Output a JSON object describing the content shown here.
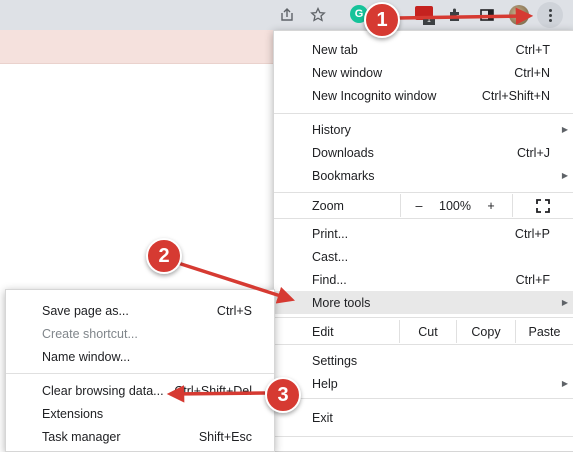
{
  "chrome_menu": {
    "new_tab": {
      "label": "New tab",
      "shortcut": "Ctrl+T"
    },
    "new_window": {
      "label": "New window",
      "shortcut": "Ctrl+N"
    },
    "new_incognito": {
      "label": "New Incognito window",
      "shortcut": "Ctrl+Shift+N"
    },
    "history": {
      "label": "History"
    },
    "downloads": {
      "label": "Downloads",
      "shortcut": "Ctrl+J"
    },
    "bookmarks": {
      "label": "Bookmarks"
    },
    "zoom": {
      "label": "Zoom",
      "minus": "–",
      "value": "100%",
      "plus": "+"
    },
    "print": {
      "label": "Print...",
      "shortcut": "Ctrl+P"
    },
    "cast": {
      "label": "Cast..."
    },
    "find": {
      "label": "Find...",
      "shortcut": "Ctrl+F"
    },
    "more_tools": {
      "label": "More tools"
    },
    "edit": {
      "label": "Edit",
      "cut": "Cut",
      "copy": "Copy",
      "paste": "Paste"
    },
    "settings": {
      "label": "Settings"
    },
    "help": {
      "label": "Help"
    },
    "exit": {
      "label": "Exit"
    }
  },
  "more_tools_menu": {
    "save_page": {
      "label": "Save page as...",
      "shortcut": "Ctrl+S"
    },
    "create_shortcut": {
      "label": "Create shortcut..."
    },
    "name_window": {
      "label": "Name window..."
    },
    "clear_browsing": {
      "label": "Clear browsing data...",
      "shortcut": "Ctrl+Shift+Del"
    },
    "extensions": {
      "label": "Extensions"
    },
    "task_manager": {
      "label": "Task manager",
      "shortcut": "Shift+Esc"
    }
  },
  "annotations": {
    "step1": "1",
    "step2": "2",
    "step3": "3",
    "color": "#d63a32"
  },
  "icons": [
    "share-icon",
    "star-icon",
    "grammarly-icon",
    "extension-icon",
    "puzzle-icon",
    "sidepanel-icon",
    "avatar",
    "kebab-menu-icon",
    "fullscreen-icon"
  ]
}
